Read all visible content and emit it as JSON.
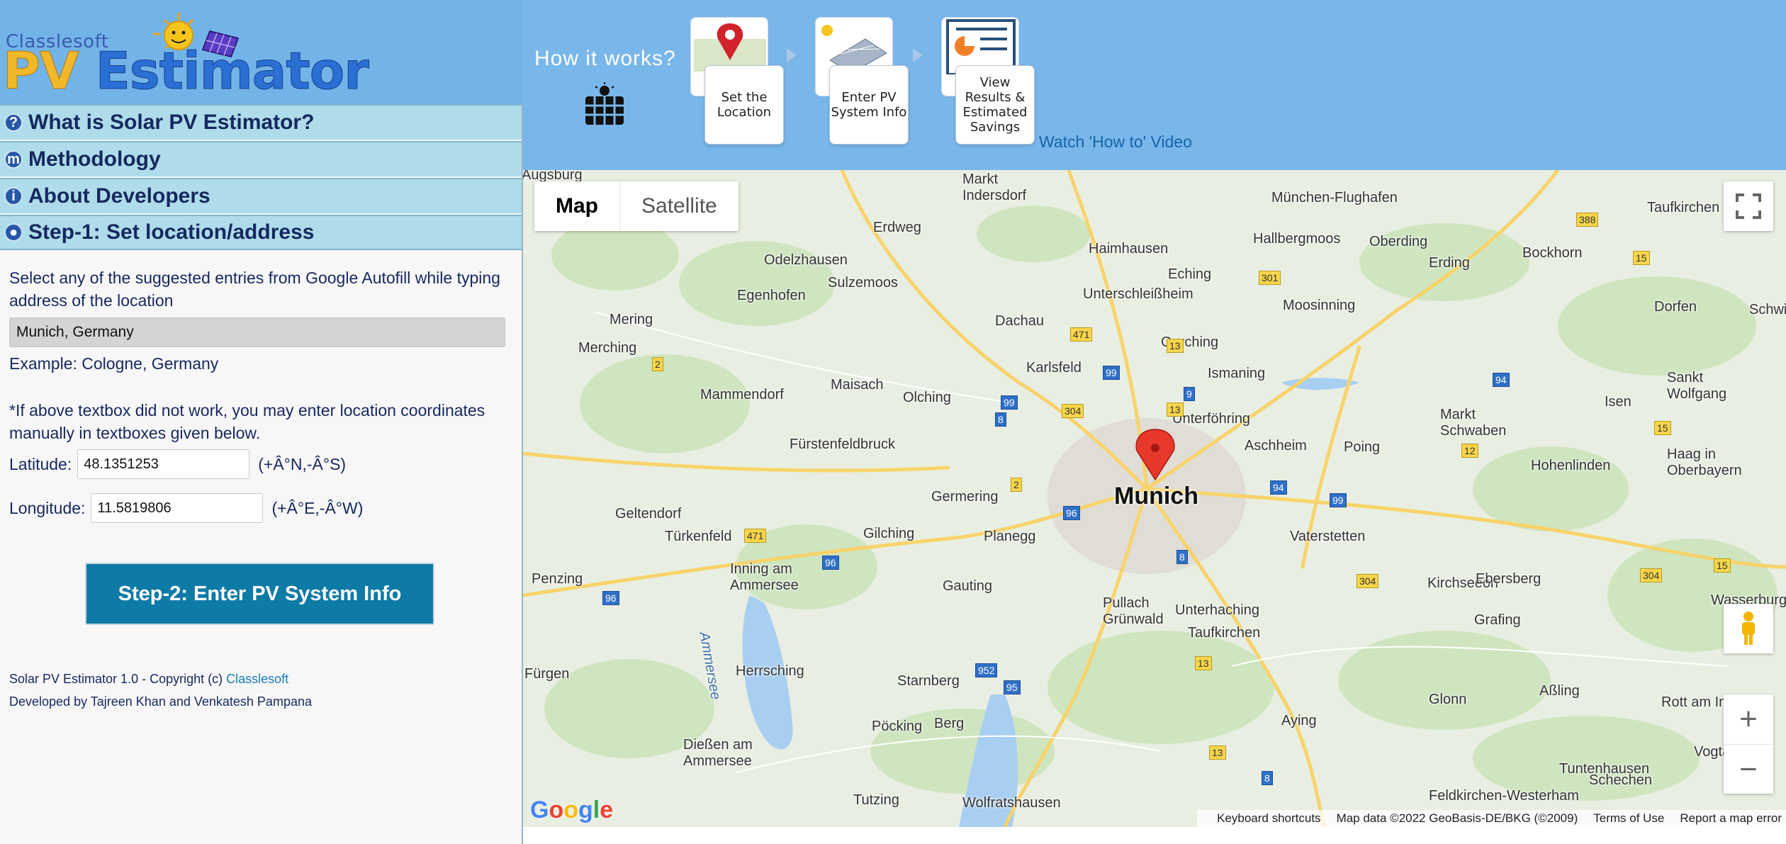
{
  "logo": {
    "small_text": "Classlesoft",
    "pv_text": "PV",
    "estimator_text": "Estimator"
  },
  "sidebar": {
    "items": [
      {
        "icon": "?",
        "label": "What is Solar PV Estimator?"
      },
      {
        "icon": "m",
        "label": "Methodology"
      },
      {
        "icon": "i",
        "label": "About Developers"
      },
      {
        "icon": "●",
        "label": "Step-1: Set location/address"
      }
    ]
  },
  "step1": {
    "instruction": "Select any of the suggested entries from Google Autofill while typing address of the location",
    "address_value": "Munich, Germany",
    "example": "Example: Cologne, Germany",
    "coord_note": "*If above textbox did not work, you may enter location coordinates manually in textboxes given below.",
    "latitude_label": "Latitude:",
    "latitude_value": "48.1351253",
    "latitude_unit": "(+Â°N,-Â°S)",
    "longitude_label": "Longitude:",
    "longitude_value": "11.5819806",
    "longitude_unit": "(+Â°E,-Â°W)",
    "next_button": "Step-2: Enter PV System Info"
  },
  "footer": {
    "copyright": "Solar PV Estimator 1.0 - Copyright (c) ",
    "company": "Classlesoft",
    "developers": "Developed by Tajreen Khan and Venkatesh Pampana"
  },
  "how_it_works": {
    "title": "How it works?",
    "steps": [
      "Set the Location",
      "Enter PV System Info",
      "View Results & Estimated Savings"
    ],
    "video_link": "Watch 'How to' Video"
  },
  "map": {
    "type_buttons": [
      "Map",
      "Satellite"
    ],
    "active_type": "Map",
    "marker_city": "Munich",
    "places": [
      "Markt Indersdorf",
      "München-Flughafen",
      "Taufkirchen",
      "Erdweg",
      "Haimhausen",
      "Hallbergmoos",
      "Oberding",
      "Bockhorn",
      "Odelzhausen",
      "Sulzemoos",
      "Eching",
      "Erding",
      "Egenhofen",
      "Unterschleißheim",
      "Mering",
      "Dachau",
      "Moosinning",
      "Dorfen",
      "Schwindegg",
      "Merching",
      "Garching",
      "Karlsfeld",
      "Ismaning",
      "Mammendorf",
      "Maisach",
      "Olching",
      "Unterföhring",
      "Isen",
      "Sankt Wolfgang",
      "Fürstenfeldbruck",
      "Aschheim",
      "Poing",
      "Markt Schwaben",
      "Hohenlinden",
      "Haag in Oberbayern",
      "Germering",
      "Munich",
      "Geltendorf",
      "Türkenfeld",
      "Gilching",
      "Planegg",
      "Vaterstetten",
      "Penzing",
      "Inning am Ammersee",
      "Gauting",
      "Kirchseeon",
      "Ebersberg",
      "Wasserburg",
      "Pullach",
      "Grünwald",
      "Unterhaching",
      "Taufkirchen",
      "Grafing",
      "Ammersee",
      "Herrsching",
      "Starnberg",
      "Aßling",
      "Glonn",
      "Aying",
      "Rott am Inn",
      "Pöcking",
      "Berg",
      "Dießen am Ammersee",
      "Tuntenhausen",
      "Vogtareuth",
      "Tutzing",
      "Wolfratshausen",
      "Feldkirchen-Westerham",
      "Schechen",
      "Fürgen",
      "Augsburg"
    ],
    "attribution": [
      "Keyboard shortcuts",
      "Map data ©2022 GeoBasis-DE/BKG (©2009)",
      "Terms of Use",
      "Report a map error"
    ],
    "google_logo": "Google"
  },
  "colors": {
    "header_blue": "#79b6ea",
    "accordion_bg": "#aedcea",
    "button_teal": "#0e7aa6",
    "link_blue": "#1565a8"
  }
}
